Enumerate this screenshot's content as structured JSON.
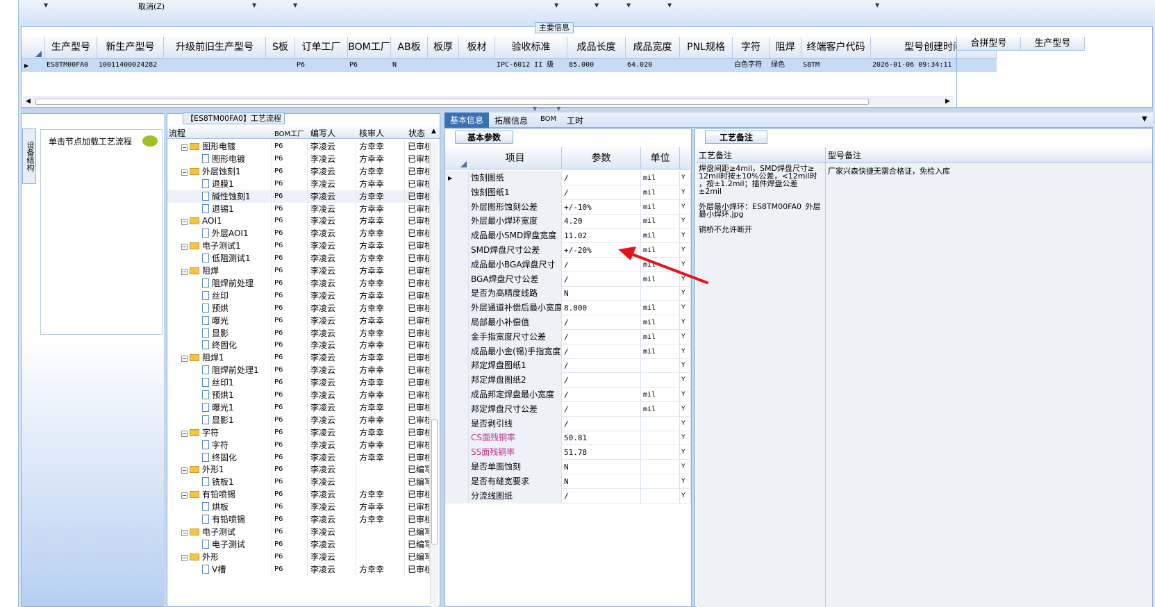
{
  "toolbar": {
    "cancel": "取消(Z)"
  },
  "main_info": {
    "group_title": "主要信息",
    "columns": [
      "生产型号",
      "新生产型号",
      "升级前旧生产型号",
      "S板",
      "订单工厂",
      "BOM工厂",
      "AB板",
      "板厚",
      "板材",
      "验收标准",
      "成品长度",
      "成品宽度",
      "PNL规格",
      "字符",
      "阻焊",
      "终端客户代码",
      "型号创建时间"
    ],
    "row": [
      "ES8TM00FA0",
      "10011400024282",
      "",
      "",
      "P6",
      "P6",
      "N",
      "",
      "",
      "IPC-6012 II 级",
      "85.000",
      "64.020",
      "",
      "白色字符",
      "绿色",
      "S8TM",
      "2026-01-06 09:34:11"
    ],
    "merge_columns": [
      "合拼型号",
      "生产型号"
    ]
  },
  "left": {
    "vtab": "设备结构",
    "hint": "单击节点加载工艺流程"
  },
  "flow": {
    "title": "【ES8TM00FA0】工艺流程",
    "columns": [
      "流程",
      "BOM工厂",
      "编写人",
      "核审人",
      "状态"
    ],
    "rows": [
      {
        "name": "图形电镀",
        "lvl": 1,
        "f": "P6",
        "w": "李凌云",
        "r": "方幸幸",
        "s": "已审核"
      },
      {
        "name": "图形电镀",
        "lvl": 2,
        "f": "P6",
        "w": "李凌云",
        "r": "方幸幸",
        "s": "已审核"
      },
      {
        "name": "外层蚀刻1",
        "lvl": 1,
        "f": "P6",
        "w": "李凌云",
        "r": "方幸幸",
        "s": "已审核"
      },
      {
        "name": "退膜1",
        "lvl": 2,
        "f": "P6",
        "w": "李凌云",
        "r": "方幸幸",
        "s": "已审核"
      },
      {
        "name": "碱性蚀刻1",
        "lvl": 2,
        "f": "P6",
        "w": "李凌云",
        "r": "方幸幸",
        "s": "已审核"
      },
      {
        "name": "退锡1",
        "lvl": 2,
        "f": "P6",
        "w": "李凌云",
        "r": "方幸幸",
        "s": "已审核"
      },
      {
        "name": "AOI1",
        "lvl": 1,
        "f": "P6",
        "w": "李凌云",
        "r": "方幸幸",
        "s": "已审核"
      },
      {
        "name": "外层AOI1",
        "lvl": 2,
        "f": "P6",
        "w": "李凌云",
        "r": "方幸幸",
        "s": "已审核"
      },
      {
        "name": "电子测试1",
        "lvl": 1,
        "f": "P6",
        "w": "李凌云",
        "r": "方幸幸",
        "s": "已审核"
      },
      {
        "name": "低阻测试1",
        "lvl": 2,
        "f": "P6",
        "w": "李凌云",
        "r": "方幸幸",
        "s": "已审核"
      },
      {
        "name": "阻焊",
        "lvl": 1,
        "f": "P6",
        "w": "李凌云",
        "r": "方幸幸",
        "s": "已审核"
      },
      {
        "name": "阻焊前处理",
        "lvl": 2,
        "f": "P6",
        "w": "李凌云",
        "r": "方幸幸",
        "s": "已审核"
      },
      {
        "name": "丝印",
        "lvl": 2,
        "f": "P6",
        "w": "李凌云",
        "r": "方幸幸",
        "s": "已审核"
      },
      {
        "name": "预烘",
        "lvl": 2,
        "f": "P6",
        "w": "李凌云",
        "r": "方幸幸",
        "s": "已审核"
      },
      {
        "name": "曝光",
        "lvl": 2,
        "f": "P6",
        "w": "李凌云",
        "r": "方幸幸",
        "s": "已审核"
      },
      {
        "name": "显影",
        "lvl": 2,
        "f": "P6",
        "w": "李凌云",
        "r": "方幸幸",
        "s": "已审核"
      },
      {
        "name": "终固化",
        "lvl": 2,
        "f": "P6",
        "w": "李凌云",
        "r": "方幸幸",
        "s": "已审核"
      },
      {
        "name": "阻焊1",
        "lvl": 1,
        "f": "P6",
        "w": "李凌云",
        "r": "方幸幸",
        "s": "已审核"
      },
      {
        "name": "阻焊前处理1",
        "lvl": 2,
        "f": "P6",
        "w": "李凌云",
        "r": "方幸幸",
        "s": "已审核"
      },
      {
        "name": "丝印1",
        "lvl": 2,
        "f": "P6",
        "w": "李凌云",
        "r": "方幸幸",
        "s": "已审核"
      },
      {
        "name": "预烘1",
        "lvl": 2,
        "f": "P6",
        "w": "李凌云",
        "r": "方幸幸",
        "s": "已审核"
      },
      {
        "name": "曝光1",
        "lvl": 2,
        "f": "P6",
        "w": "李凌云",
        "r": "方幸幸",
        "s": "已审核"
      },
      {
        "name": "显影1",
        "lvl": 2,
        "f": "P6",
        "w": "李凌云",
        "r": "方幸幸",
        "s": "已审核"
      },
      {
        "name": "字符",
        "lvl": 1,
        "f": "P6",
        "w": "李凌云",
        "r": "方幸幸",
        "s": "已审核"
      },
      {
        "name": "字符",
        "lvl": 2,
        "f": "P6",
        "w": "李凌云",
        "r": "方幸幸",
        "s": "已审核"
      },
      {
        "name": "终固化",
        "lvl": 2,
        "f": "P6",
        "w": "李凌云",
        "r": "方幸幸",
        "s": "已审核"
      },
      {
        "name": "外形1",
        "lvl": 1,
        "f": "P6",
        "w": "李凌云",
        "r": "",
        "s": "已编写"
      },
      {
        "name": "铣板1",
        "lvl": 2,
        "f": "P6",
        "w": "李凌云",
        "r": "",
        "s": "已编写"
      },
      {
        "name": "有铅喷锡",
        "lvl": 1,
        "f": "P6",
        "w": "李凌云",
        "r": "方幸幸",
        "s": "已审核"
      },
      {
        "name": "烘板",
        "lvl": 2,
        "f": "P6",
        "w": "李凌云",
        "r": "方幸幸",
        "s": "已审核"
      },
      {
        "name": "有铅喷锡",
        "lvl": 2,
        "f": "P6",
        "w": "李凌云",
        "r": "方幸幸",
        "s": "已审核"
      },
      {
        "name": "电子测试",
        "lvl": 1,
        "f": "P6",
        "w": "李凌云",
        "r": "",
        "s": "已编写"
      },
      {
        "name": "电子测试",
        "lvl": 2,
        "f": "P6",
        "w": "李凌云",
        "r": "",
        "s": "已编写"
      },
      {
        "name": "外形",
        "lvl": 1,
        "f": "P6",
        "w": "李凌云",
        "r": "",
        "s": "已编写"
      },
      {
        "name": "V槽",
        "lvl": 2,
        "f": "P6",
        "w": "李凌云",
        "r": "方幸幸",
        "s": "已审核"
      }
    ]
  },
  "tabs": [
    "基本信息",
    "拓展信息",
    "BOM",
    "工时"
  ],
  "basic": {
    "subtab": "基本参数",
    "columns": [
      "项目",
      "参数",
      "单位"
    ],
    "rows": [
      {
        "item": "蚀刻图纸",
        "val": "/",
        "unit": "mil",
        "y": "Y"
      },
      {
        "item": "蚀刻图纸1",
        "val": "/",
        "unit": "mil",
        "y": "Y"
      },
      {
        "item": "外层图形蚀刻公差",
        "val": "+/-10%",
        "unit": "mil",
        "y": "Y"
      },
      {
        "item": "外层最小焊环宽度",
        "val": "4.20",
        "unit": "mil",
        "y": "Y"
      },
      {
        "item": "成品最小SMD焊盘宽度",
        "val": "11.02",
        "unit": "mil",
        "y": "Y"
      },
      {
        "item": "SMD焊盘尺寸公差",
        "val": "+/-20%",
        "unit": "mil",
        "y": "Y"
      },
      {
        "item": "成品最小BGA焊盘尺寸",
        "val": "/",
        "unit": "mil",
        "y": "Y"
      },
      {
        "item": "BGA焊盘尺寸公差",
        "val": "/",
        "unit": "mil",
        "y": "Y"
      },
      {
        "item": "是否为高精度线路",
        "val": "N",
        "unit": "",
        "y": "Y"
      },
      {
        "item": "外层通道补偿后最小宽度",
        "val": "8.000",
        "unit": "mil",
        "y": "Y"
      },
      {
        "item": "局部最小补偿值",
        "val": "/",
        "unit": "mil",
        "y": "Y"
      },
      {
        "item": "金手指宽度尺寸公差",
        "val": "/",
        "unit": "mil",
        "y": "Y"
      },
      {
        "item": "成品最小金(锡)手指宽度",
        "val": "/",
        "unit": "mil",
        "y": "Y"
      },
      {
        "item": "邦定焊盘图纸1",
        "val": "/",
        "unit": "",
        "y": "Y"
      },
      {
        "item": "邦定焊盘图纸2",
        "val": "/",
        "unit": "",
        "y": "Y"
      },
      {
        "item": "成品邦定焊盘最小宽度",
        "val": "/",
        "unit": "mil",
        "y": "Y"
      },
      {
        "item": "邦定焊盘尺寸公差",
        "val": "/",
        "unit": "mil",
        "y": "Y"
      },
      {
        "item": "是否剥引线",
        "val": "/",
        "unit": "",
        "y": "Y"
      },
      {
        "item": "CS面残铜率",
        "val": "50.81",
        "unit": "",
        "y": "Y",
        "pink": true
      },
      {
        "item": "SS面残铜率",
        "val": "51.78",
        "unit": "",
        "y": "Y",
        "pink": true
      },
      {
        "item": "是否单面蚀刻",
        "val": "N",
        "unit": "",
        "y": "Y"
      },
      {
        "item": "是否有缝宽要求",
        "val": "N",
        "unit": "",
        "y": "Y"
      },
      {
        "item": "分流线图纸",
        "val": "/",
        "unit": "",
        "y": "Y"
      }
    ]
  },
  "notes": {
    "tab": "工艺备注",
    "col1": "工艺备注",
    "col2": "型号备注",
    "process_note_lines": [
      "焊盘间距≥4mil，SMD焊盘尺寸≥",
      "12mil时按±10%公差，<12mil时",
      "，按±1.2mil；插件焊盘公差",
      "±2mil",
      "",
      "外层最小焊环：ES8TM00FA0_外层",
      "最小焊环.jpg",
      "",
      "铜桥不允许断开"
    ],
    "model_note": "厂家兴森快捷无需合格证，免检入库"
  },
  "colors": {
    "accent": "#3b6fb6",
    "selection": "#c5dcf6",
    "pink": "#c0308a",
    "arrow": "#e3141c"
  }
}
